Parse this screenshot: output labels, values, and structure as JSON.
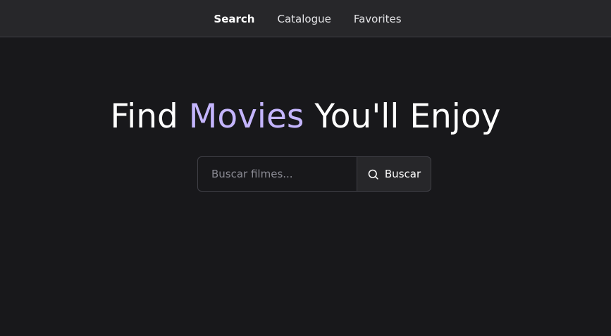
{
  "nav": {
    "items": [
      {
        "label": "Search",
        "active": true
      },
      {
        "label": "Catalogue",
        "active": false
      },
      {
        "label": "Favorites",
        "active": false
      }
    ]
  },
  "hero": {
    "title_part1": "Find ",
    "title_accent": "Movies",
    "title_part2": " You'll Enjoy"
  },
  "search": {
    "placeholder": "Buscar filmes...",
    "value": "",
    "button_label": "Buscar",
    "button_icon": "search-icon"
  },
  "colors": {
    "background": "#18181b",
    "navbar": "#27272a",
    "accent": "#c4b5fd",
    "border": "#3f3f46"
  }
}
